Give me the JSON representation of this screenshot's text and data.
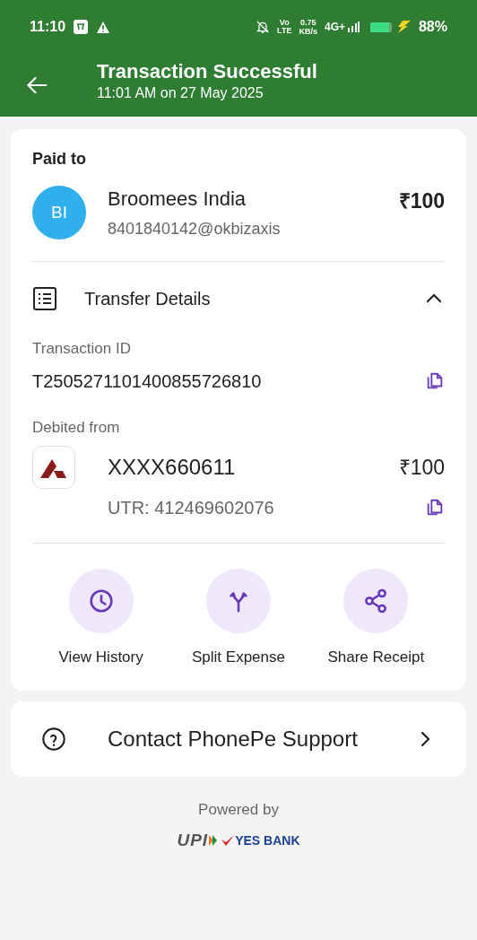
{
  "status_bar": {
    "time": "11:10",
    "volte_top": "Vo",
    "volte_bottom": "LTE",
    "speed_value": "0.75",
    "speed_unit": "KB/s",
    "network": "4G+",
    "battery": "88%"
  },
  "header": {
    "title": "Transaction Successful",
    "subtitle": "11:01 AM on 27 May 2025"
  },
  "paid_to": {
    "label": "Paid to",
    "initials": "BI",
    "name": "Broomees India",
    "upi_id": "8401840142@okbizaxis",
    "amount": "₹100"
  },
  "transfer_details": {
    "title": "Transfer Details",
    "expanded": true,
    "transaction_id_label": "Transaction ID",
    "transaction_id": "T2505271101400855726810",
    "debited_label": "Debited from",
    "account": "XXXX660611",
    "account_amount": "₹100",
    "utr": "UTR: 412469602076"
  },
  "actions": [
    {
      "kind": "history",
      "label": "View History"
    },
    {
      "kind": "split",
      "label": "Split Expense"
    },
    {
      "kind": "share",
      "label": "Share Receipt"
    }
  ],
  "support": {
    "label": "Contact PhonePe Support"
  },
  "footer": {
    "powered_by": "Powered by",
    "upi": "UPI",
    "bank": "YES BANK"
  }
}
